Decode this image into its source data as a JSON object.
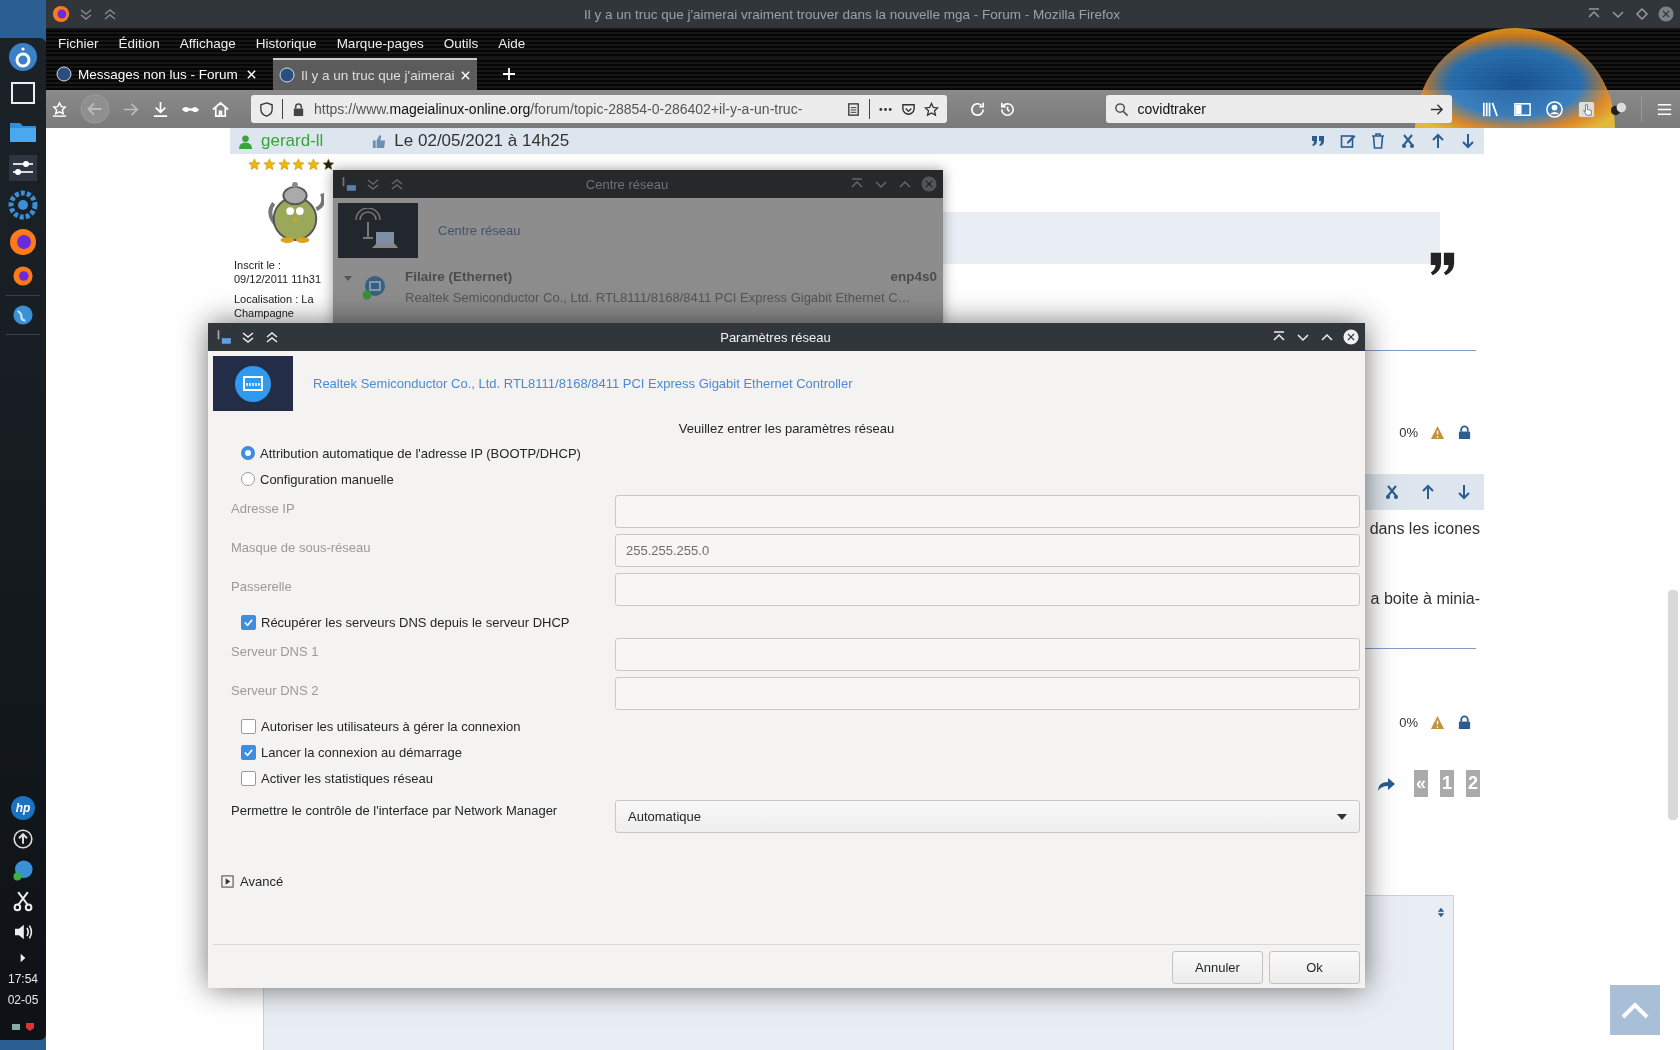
{
  "taskbar": {
    "badge": "hp",
    "time": "17:54",
    "date": "02-05"
  },
  "window": {
    "title": "Il y a un truc que j'aimerai vraiment trouver dans la nouvelle mga - Forum - Mozilla Firefox"
  },
  "menu": [
    "Fichier",
    "Édition",
    "Affichage",
    "Historique",
    "Marque-pages",
    "Outils",
    "Aide"
  ],
  "tabs": [
    {
      "label": "Messages non lus - Forum",
      "selected": false
    },
    {
      "label": "Il y a un truc que j'aimerai",
      "selected": true
    }
  ],
  "address_bar": {
    "scheme": "https://www.",
    "domain": "mageialinux-online.org",
    "path": "/forum/topic-28854-0-286402+il-y-a-un-truc-"
  },
  "search": {
    "value": "covidtraker"
  },
  "forum": {
    "post": {
      "author": "gerard-ll",
      "date": "Le 02/05/2021 à 14h25",
      "stars": 5,
      "registered": "Inscrit le : 09/12/2011 11h31",
      "location": "Localisation : La Champagne"
    },
    "ratings": [
      "0%",
      "0%"
    ],
    "fragments": [
      "dans les icones",
      "a boite à minia-"
    ],
    "pagination": [
      "«",
      "1",
      "2"
    ]
  },
  "network_center": {
    "title": "Centre réseau",
    "heading": "Centre réseau",
    "connection": {
      "name": "Filaire (Ethernet)",
      "interface": "enp4s0",
      "device": "Realtek Semiconductor Co., Ltd. RTL8111/8168/8411 PCI Express Gigabit Ethernet C…",
      "expanded": true,
      "connected": true
    }
  },
  "dialog": {
    "title": "Paramètres réseau",
    "device": "Realtek Semiconductor Co., Ltd. RTL8111/8168/8411 PCI Express Gigabit Ethernet Controller",
    "prompt": "Veuillez entrer les paramètres réseau",
    "ip_modes": [
      {
        "label": "Attribution automatique de l'adresse IP (BOOTP/DHCP)",
        "selected": true
      },
      {
        "label": "Configuration manuelle",
        "selected": false
      }
    ],
    "rows": [
      {
        "kind": "field",
        "label": "Adresse IP",
        "disabled": true
      },
      {
        "kind": "field",
        "label": "Masque de sous-réseau",
        "value": "255.255.255.0",
        "disabled": true
      },
      {
        "kind": "field",
        "label": "Passerelle",
        "disabled": true
      },
      {
        "kind": "checkbox",
        "label": "Récupérer les serveurs DNS depuis le serveur DHCP",
        "checked": true
      },
      {
        "kind": "field",
        "label": "Serveur DNS 1",
        "disabled": true
      },
      {
        "kind": "field",
        "label": "Serveur DNS 2",
        "disabled": true
      },
      {
        "kind": "checkbox",
        "label": "Autoriser les utilisateurs à gérer la connexion",
        "checked": false
      },
      {
        "kind": "checkbox",
        "label": "Lancer la connexion au démarrage",
        "checked": true
      },
      {
        "kind": "checkbox",
        "label": "Activer les statistiques réseau",
        "checked": false
      },
      {
        "kind": "select",
        "label": "Permettre le contrôle de l'interface par Network Manager",
        "value": "Automatique"
      }
    ],
    "advanced": {
      "label": "Avancé",
      "expanded": false
    },
    "buttons": [
      "Annuler",
      "Ok"
    ]
  }
}
